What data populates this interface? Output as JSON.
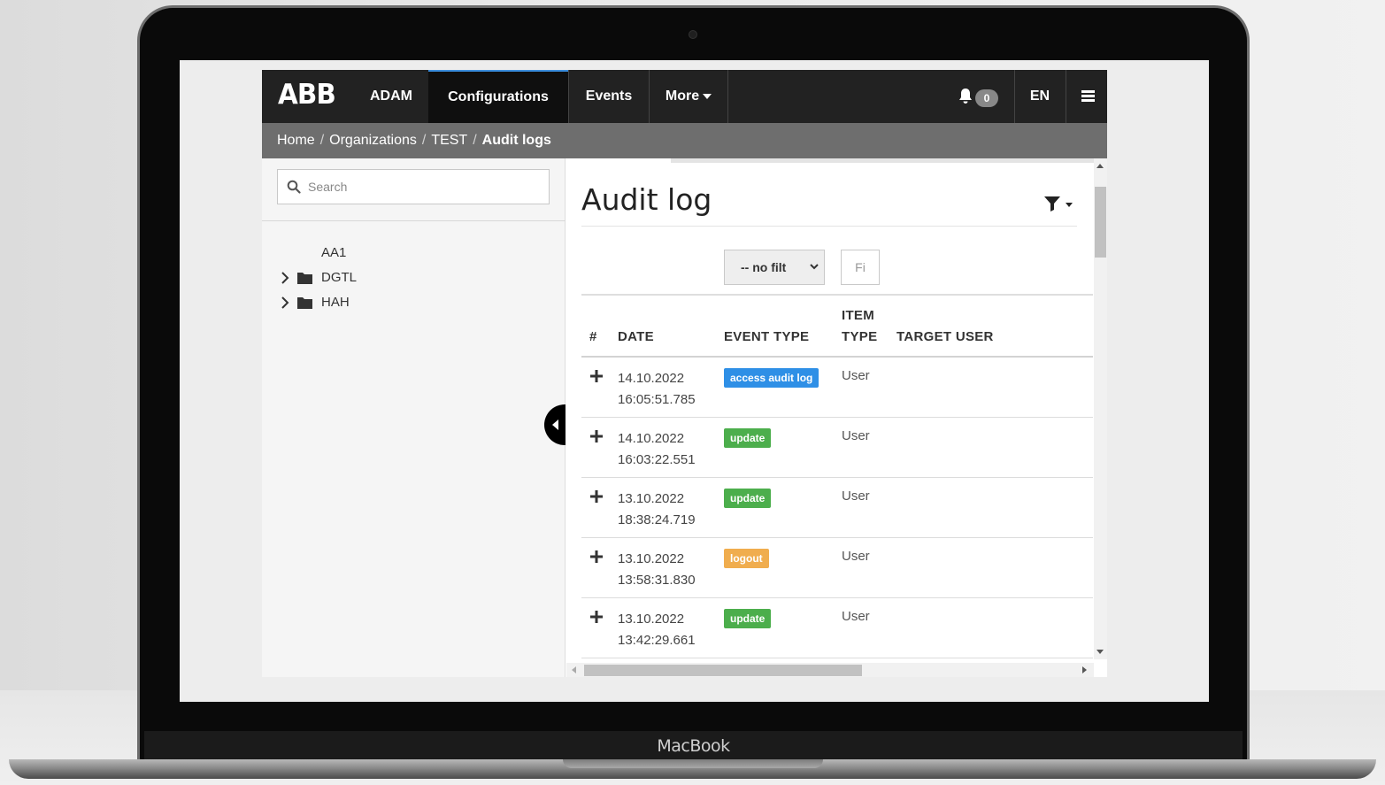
{
  "device": {
    "label": "MacBook"
  },
  "topnav": {
    "logo": "ABB",
    "items": [
      {
        "label": "ADAM"
      },
      {
        "label": "Configurations"
      },
      {
        "label": "Events"
      },
      {
        "label": "More"
      }
    ],
    "active_item": "Configurations",
    "notifications_count": "0",
    "language": "EN"
  },
  "breadcrumb": {
    "items": [
      "Home",
      "Organizations",
      "TEST",
      "Audit logs"
    ]
  },
  "sidebar": {
    "search_placeholder": "Search",
    "tree": [
      {
        "label": "AA1",
        "has_children": false
      },
      {
        "label": "DGTL",
        "has_children": true
      },
      {
        "label": "HAH",
        "has_children": true
      }
    ]
  },
  "main": {
    "title": "Audit log",
    "filter_select_value": "-- no filt",
    "filter_button_label": "Fi",
    "table": {
      "columns": [
        "#",
        "DATE",
        "EVENT TYPE",
        "ITEM",
        "TYPE",
        "TARGET USER"
      ],
      "rows": [
        {
          "date": "14.10.2022",
          "time": "16:05:51.785",
          "event_type": "access audit log",
          "event_color": "#2e8fe6",
          "item_type": "User"
        },
        {
          "date": "14.10.2022",
          "time": "16:03:22.551",
          "event_type": "update",
          "event_color": "#4cae4c",
          "item_type": "User"
        },
        {
          "date": "13.10.2022",
          "time": "18:38:24.719",
          "event_type": "update",
          "event_color": "#4cae4c",
          "item_type": "User"
        },
        {
          "date": "13.10.2022",
          "time": "13:58:31.830",
          "event_type": "logout",
          "event_color": "#f0ad4e",
          "item_type": "User"
        },
        {
          "date": "13.10.2022",
          "time": "13:42:29.661",
          "event_type": "update",
          "event_color": "#4cae4c",
          "item_type": "User"
        }
      ]
    }
  }
}
